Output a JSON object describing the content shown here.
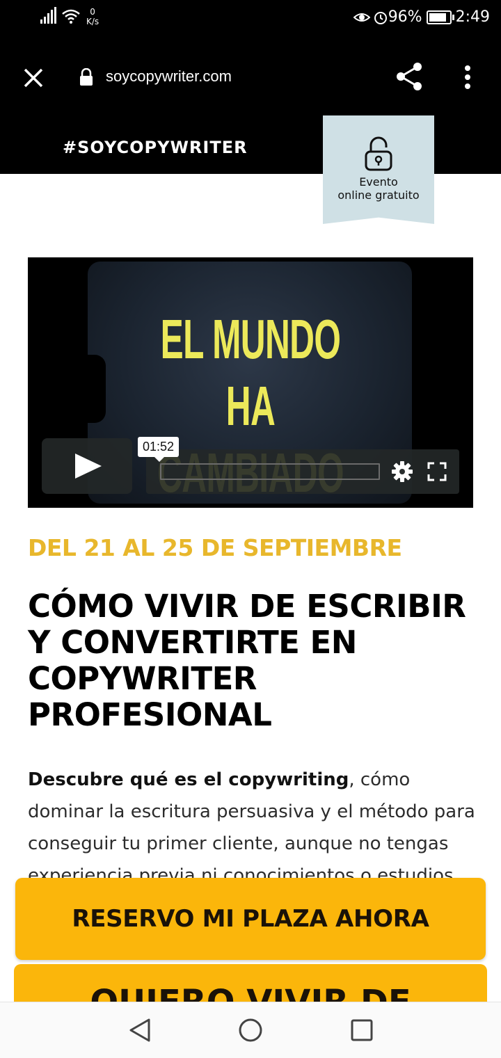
{
  "status_bar": {
    "net_speed_value": "0",
    "net_speed_unit": "K/s",
    "battery": "96%",
    "time": "2:49"
  },
  "browser": {
    "url": "soycopywriter.com"
  },
  "site_header": {
    "brand": "#SOYCOPYWRITER",
    "event_badge_line1": "Evento",
    "event_badge_line2": "online gratuito"
  },
  "video": {
    "title_line1": "EL MUNDO",
    "title_line2": "HA CAMBIADO",
    "time_tooltip": "01:52"
  },
  "content": {
    "dates": "DEL 21 AL 25 DE SEPTIEMBRE",
    "headline": "CÓMO VIVIR DE ESCRIBIR Y CONVERTIRTE EN COPYWRITER PROFESIONAL",
    "desc_bold": "Descubre qué es el copywriting",
    "desc_rest": ", cómo dominar la escritura persuasiva y el método para conseguir tu primer cliente, aunque no tengas experiencia previa ni conocimientos o estudios de marketing."
  },
  "cta": {
    "primary_label": "RESERVO MI PLAZA AHORA",
    "secondary_label": "QUIERO VIVIR DE"
  },
  "colors": {
    "accent_yellow": "#fbb60b",
    "dates_gold": "#e8b72c",
    "badge_bg": "#cfe0e5",
    "video_text": "#ece95a"
  }
}
